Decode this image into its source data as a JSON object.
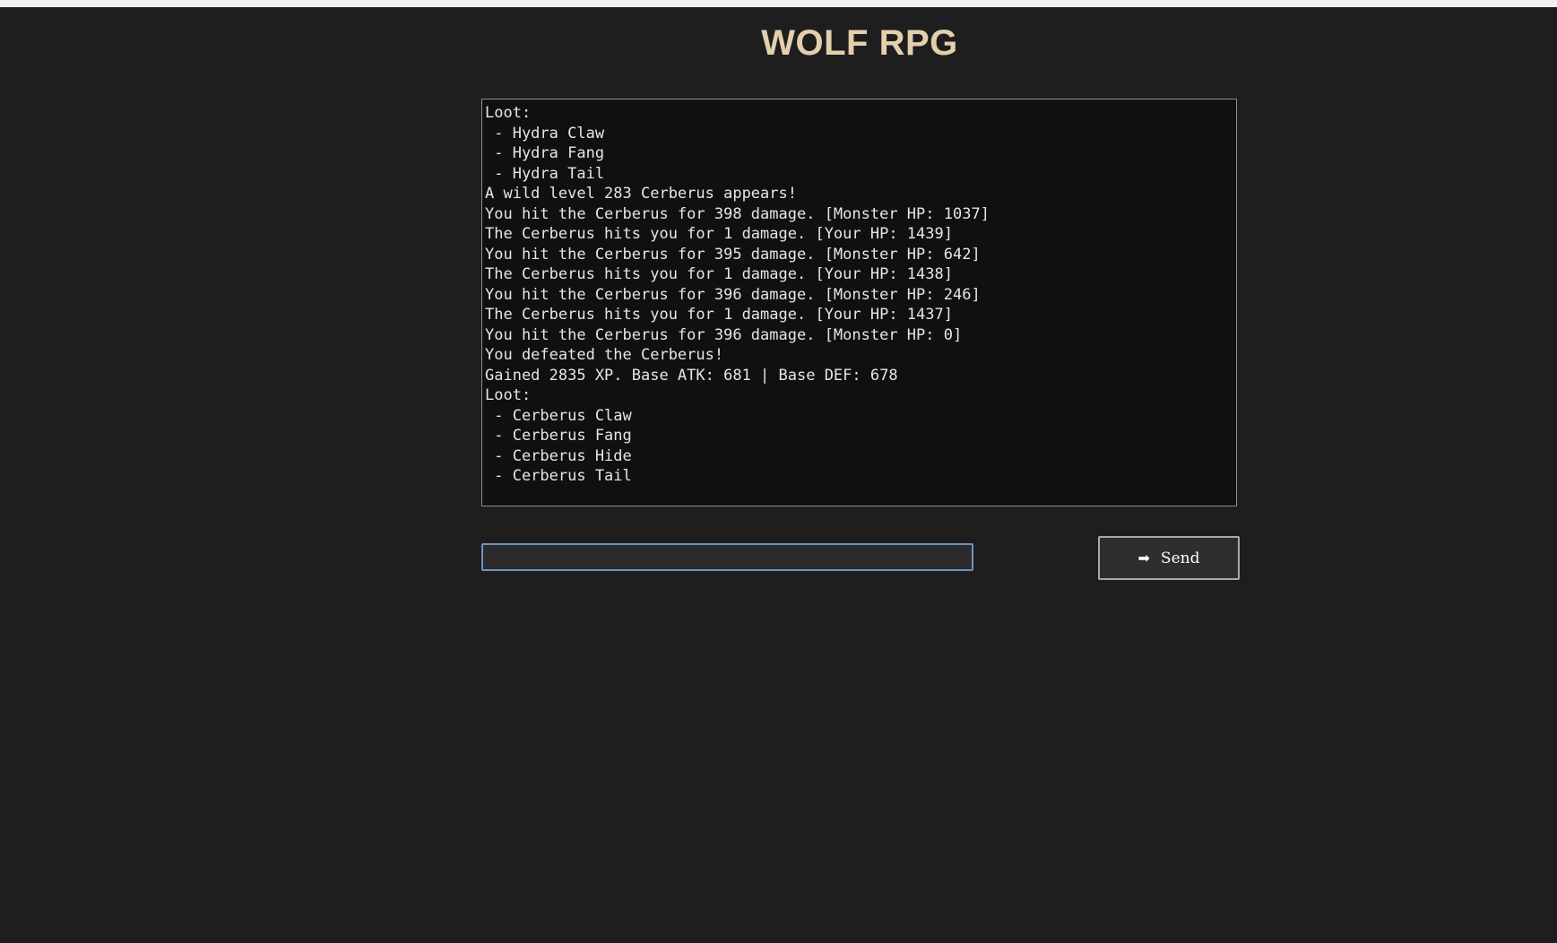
{
  "header": {
    "title": "WOLF RPG"
  },
  "log": {
    "lines": [
      "Loot:",
      " - Hydra Claw",
      " - Hydra Fang",
      " - Hydra Tail",
      "A wild level 283 Cerberus appears!",
      "You hit the Cerberus for 398 damage. [Monster HP: 1037]",
      "The Cerberus hits you for 1 damage. [Your HP: 1439]",
      "You hit the Cerberus for 395 damage. [Monster HP: 642]",
      "The Cerberus hits you for 1 damage. [Your HP: 1438]",
      "You hit the Cerberus for 396 damage. [Monster HP: 246]",
      "The Cerberus hits you for 1 damage. [Your HP: 1437]",
      "You hit the Cerberus for 396 damage. [Monster HP: 0]",
      "You defeated the Cerberus!",
      "Gained 2835 XP. Base ATK: 681 | Base DEF: 678",
      "Loot:",
      " - Cerberus Claw",
      " - Cerberus Fang",
      " - Cerberus Hide",
      " - Cerberus Tail"
    ]
  },
  "input": {
    "value": "",
    "placeholder": ""
  },
  "send_button": {
    "label": "Send",
    "icon": "arrow-right-icon"
  },
  "colors": {
    "background": "#1e1e1e",
    "title": "#e3cfad",
    "log_background": "#101010",
    "input_border": "#6e94b8"
  }
}
